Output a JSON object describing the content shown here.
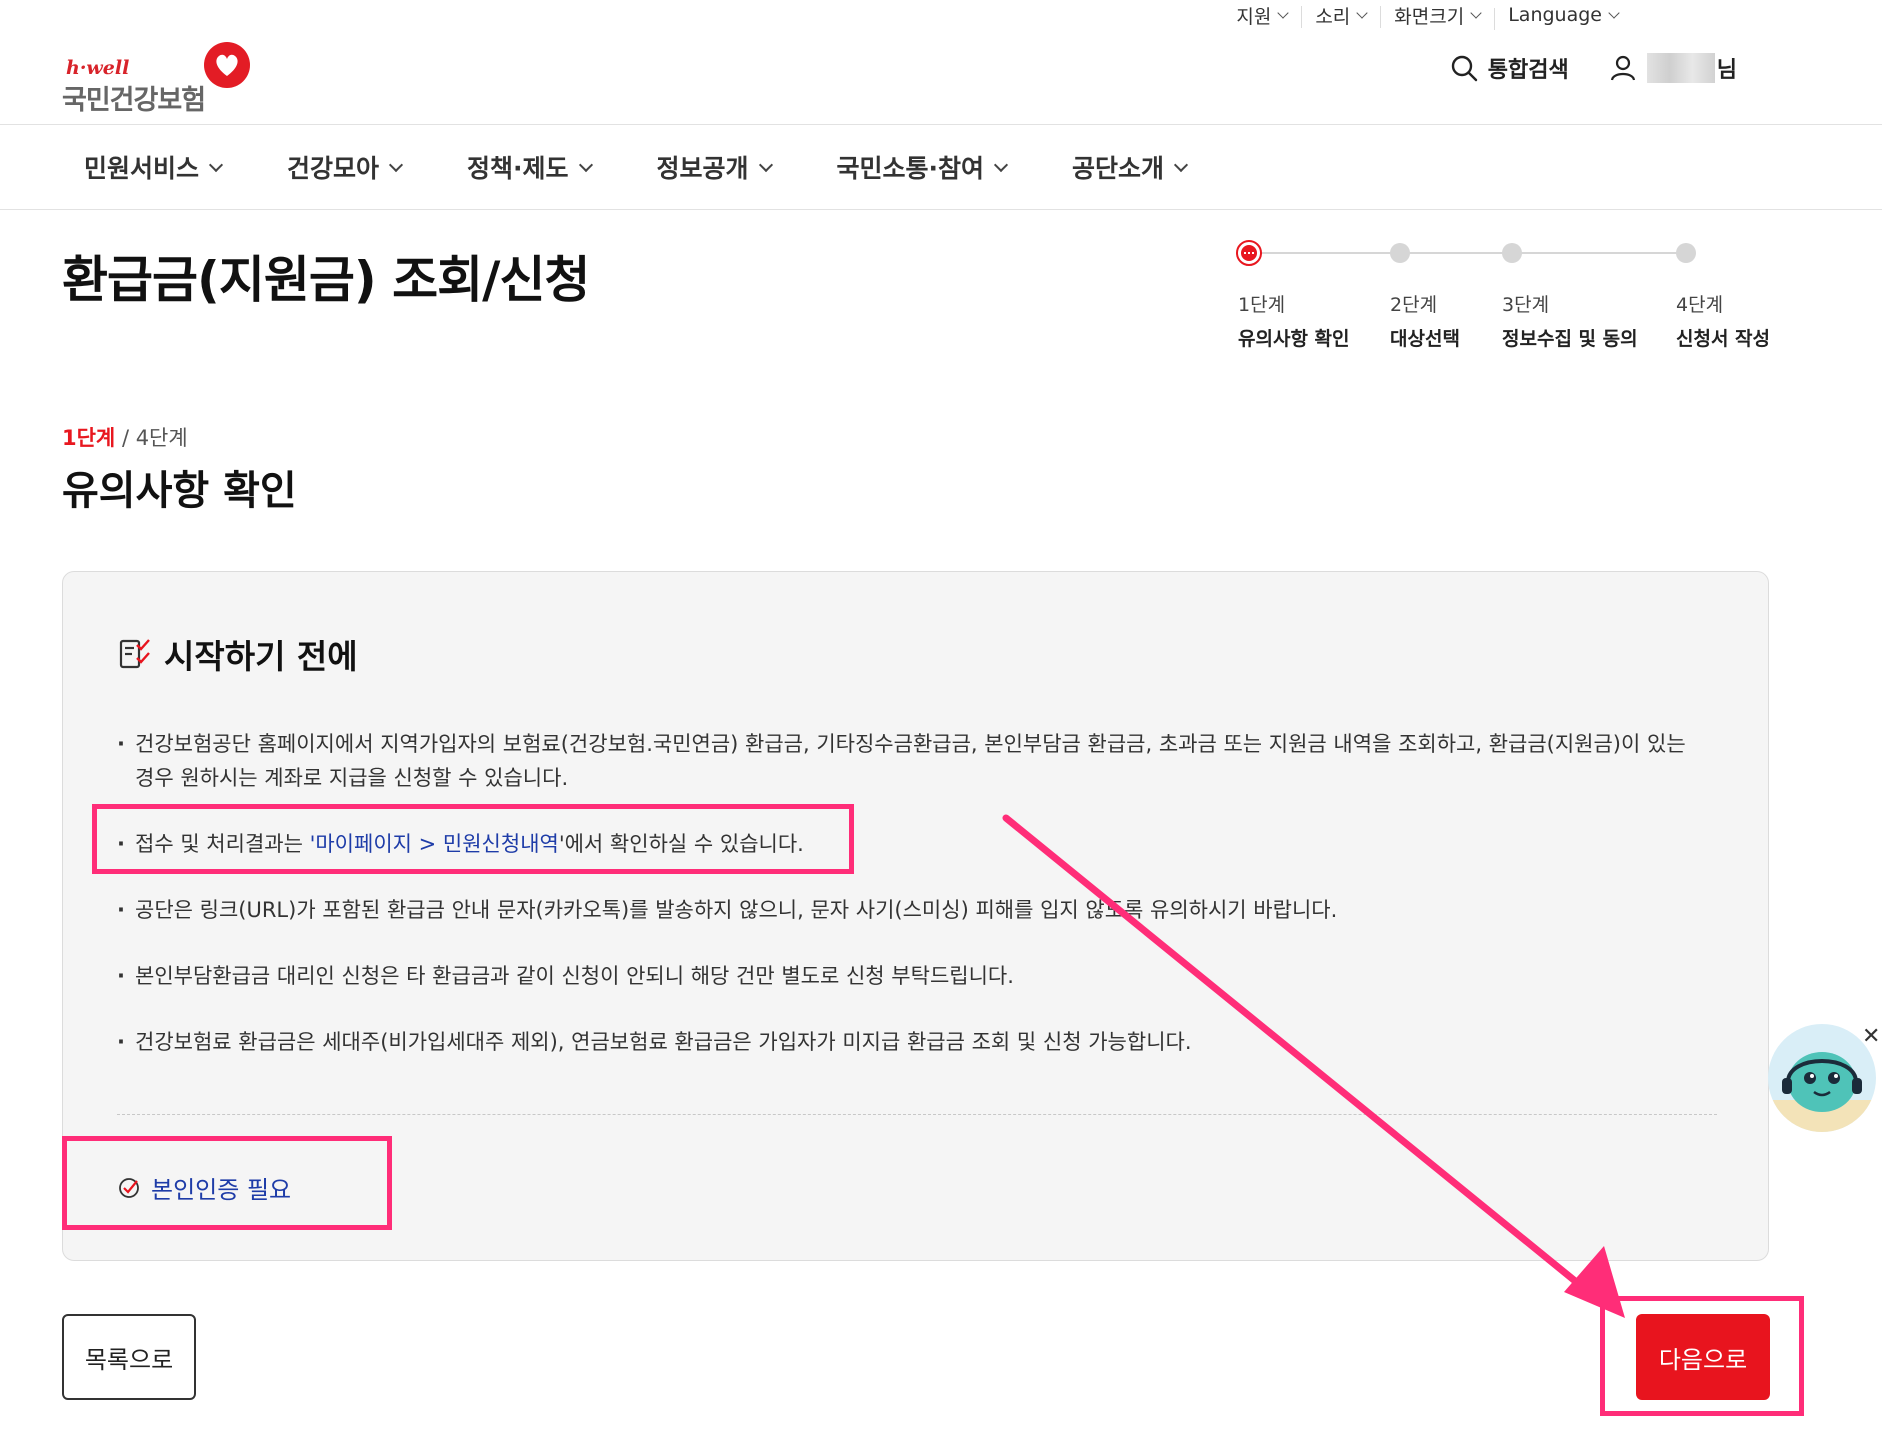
{
  "utility": {
    "items": [
      {
        "label": "지원"
      },
      {
        "label": "소리"
      },
      {
        "label": "화면크기"
      },
      {
        "label": "Language"
      }
    ]
  },
  "header": {
    "logo_brand": "h·well",
    "logo_org": "국민건강보험",
    "search_label": "통합검색",
    "user_suffix": "님"
  },
  "nav": {
    "items": [
      {
        "label": "민원서비스"
      },
      {
        "label": "건강모아"
      },
      {
        "label": "정책·제도"
      },
      {
        "label": "정보공개"
      },
      {
        "label": "국민소통·참여"
      },
      {
        "label": "공단소개"
      }
    ]
  },
  "page": {
    "title": "환급금(지원금) 조회/신청"
  },
  "stepper": {
    "steps": [
      {
        "num": "1단계",
        "label": "유의사항 확인",
        "active": true
      },
      {
        "num": "2단계",
        "label": "대상선택",
        "active": false
      },
      {
        "num": "3단계",
        "label": "정보수집 및 동의",
        "active": false
      },
      {
        "num": "4단계",
        "label": "신청서 작성",
        "active": false
      }
    ]
  },
  "step_info": {
    "current": "1단계",
    "total": " / 4단계",
    "section_title": "유의사항 확인"
  },
  "notice": {
    "heading": "시작하기 전에",
    "items": [
      {
        "text": "건강보험공단 홈페이지에서 지역가입자의 보험료(건강보험.국민연금) 환급금, 기타징수금환급금, 본인부담금 환급금, 초과금 또는 지원금 내역을 조회하고, 환급금(지원금)이 있는 경우 원하시는 계좌로 지급을 신청할 수 있습니다."
      },
      {
        "before": "접수 및 처리결과는 ",
        "link": "'마이페이지 > 민원신청내역",
        "after": "'에서 확인하실 수 있습니다."
      },
      {
        "text": "공단은 링크(URL)가 포함된 환급금 안내 문자(카카오톡)를 발송하지 않으니, 문자 사기(스미싱) 피해를 입지 않도록 유의하시기 바랍니다."
      },
      {
        "text": "본인부담환급금 대리인 신청은 타 환급금과 같이 신청이 안되니 해당 건만 별도로 신청 부탁드립니다."
      },
      {
        "text": "건강보험료 환급금은 세대주(비가입세대주 제외), 연금보험료 환급금은 가입자가 미지급 환급금 조회 및 신청 가능합니다."
      }
    ],
    "auth_required": "본인인증 필요"
  },
  "buttons": {
    "list": "목록으로",
    "next": "다음으로"
  },
  "colors": {
    "accent": "#e8141e",
    "link": "#1e3ca8",
    "annotation": "#ff2d78"
  },
  "icons": {
    "search": "search-icon",
    "user": "user-icon",
    "checklist": "checklist-icon",
    "check_circle": "check-circle-icon",
    "close": "close-icon"
  }
}
